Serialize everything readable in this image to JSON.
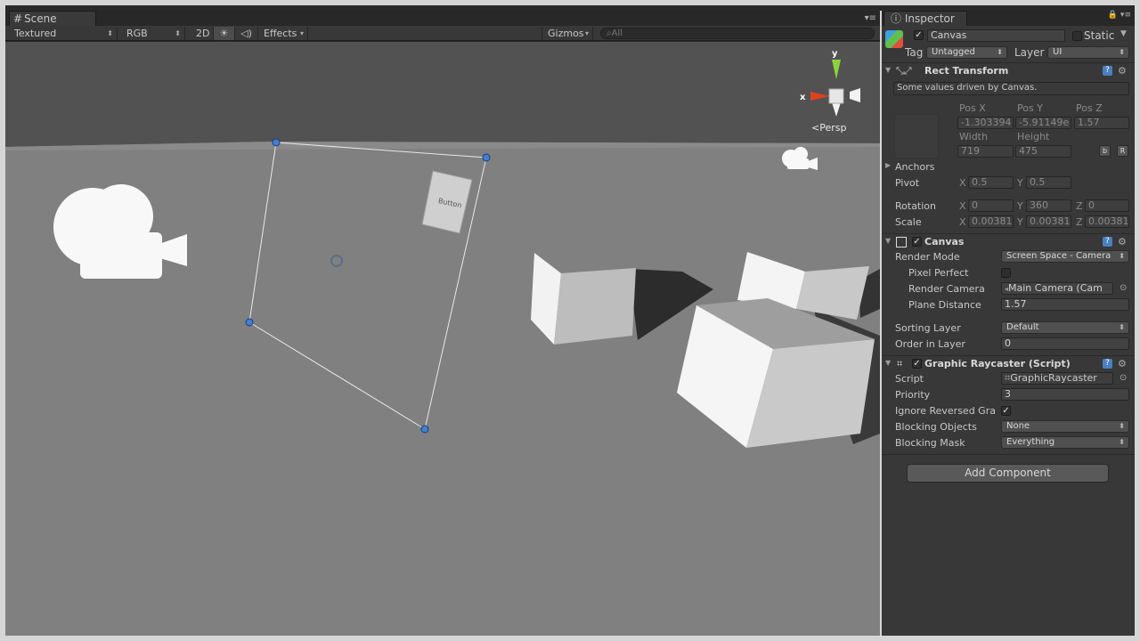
{
  "scene": {
    "tab_label": "Scene",
    "toolbar": {
      "shading": "Textured",
      "render": "RGB",
      "mode_2d": "2D",
      "effects": "Effects",
      "gizmos": "Gizmos",
      "search_placeholder": "All"
    },
    "persp_label": "Persp",
    "gizmo_axes": {
      "x": "x",
      "y": "y"
    },
    "button_text": "Button"
  },
  "inspector": {
    "tab_label": "Inspector",
    "object": {
      "name": "Canvas",
      "static_label": "Static",
      "tag_label": "Tag",
      "tag_value": "Untagged",
      "layer_label": "Layer",
      "layer_value": "UI"
    },
    "rect_transform": {
      "title": "Rect Transform",
      "note": "Some values driven by Canvas.",
      "pos_x_label": "Pos X",
      "pos_y_label": "Pos Y",
      "pos_z_label": "Pos Z",
      "pos_x": "-1.303394",
      "pos_y": "-5.91149e",
      "pos_z": "1.57",
      "width_label": "Width",
      "height_label": "Height",
      "width": "719",
      "height": "475",
      "b_btn": "b",
      "r_btn": "R",
      "anchors_label": "Anchors",
      "pivot_label": "Pivot",
      "pivot_x": "0.5",
      "pivot_y": "0.5",
      "rotation_label": "Rotation",
      "rot_x": "0",
      "rot_y": "360",
      "rot_z": "0",
      "scale_label": "Scale",
      "scale_x": "0.00381",
      "scale_y": "0.00381",
      "scale_z": "0.00381",
      "x": "X",
      "y": "Y",
      "z": "Z"
    },
    "canvas": {
      "title": "Canvas",
      "render_mode_label": "Render Mode",
      "render_mode": "Screen Space - Camera",
      "pixel_perfect_label": "Pixel Perfect",
      "render_camera_label": "Render Camera",
      "render_camera": "Main Camera (Cam",
      "plane_distance_label": "Plane Distance",
      "plane_distance": "1.57",
      "sorting_layer_label": "Sorting Layer",
      "sorting_layer": "Default",
      "order_label": "Order in Layer",
      "order": "0"
    },
    "raycaster": {
      "title": "Graphic Raycaster (Script)",
      "script_label": "Script",
      "script": "GraphicRaycaster",
      "priority_label": "Priority",
      "priority": "3",
      "ignore_label": "Ignore Reversed Gra",
      "blocking_objects_label": "Blocking Objects",
      "blocking_objects": "None",
      "blocking_mask_label": "Blocking Mask",
      "blocking_mask": "Everything"
    },
    "add_component": "Add Component"
  }
}
